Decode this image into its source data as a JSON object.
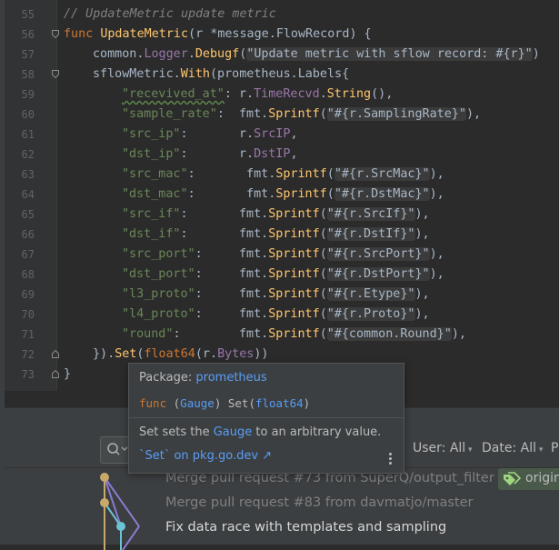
{
  "editor": {
    "lines": [
      {
        "n": "55"
      },
      {
        "n": "56"
      },
      {
        "n": "57"
      },
      {
        "n": "58"
      },
      {
        "n": "59"
      },
      {
        "n": "60"
      },
      {
        "n": "61"
      },
      {
        "n": "62"
      },
      {
        "n": "63"
      },
      {
        "n": "64"
      },
      {
        "n": "65"
      },
      {
        "n": "66"
      },
      {
        "n": "67"
      },
      {
        "n": "68"
      },
      {
        "n": "69"
      },
      {
        "n": "70"
      },
      {
        "n": "71"
      },
      {
        "n": "72"
      },
      {
        "n": "73"
      }
    ],
    "code": {
      "l55": "// UpdateMetric update metric",
      "l56_kw": "func",
      "l56_fn": "UpdateMetric",
      "l56_rest_a": "(r *",
      "l56_pkg": "message",
      "l56_dot": ".",
      "l56_type": "FlowRecord",
      "l56_rest_b": ") {",
      "l57_a": "common.",
      "l57_field": "Logger",
      "l57_b": ".",
      "l57_call": "Debugf",
      "l57_c": "(",
      "l57_str": "\"Update metric with sflow record: #{r}\"",
      "l57_d": ")",
      "l58_a": "sflowMetric.",
      "l58_call": "With",
      "l58_b": "(prometheus.",
      "l58_type": "Labels",
      "l58_c": "{",
      "l59_str": "\"recevived_at\"",
      "l59_a": ": r.",
      "l59_field": "TimeRecvd",
      "l59_b": ".",
      "l59_call": "String",
      "l59_c": "(),",
      "l60_str": "\"sample_rate\"",
      "l60_a": ":  fmt.",
      "l60_call": "Sprintf",
      "l60_b": "(",
      "l60_str2": "\"#{r.SamplingRate}\"",
      "l60_c": "),",
      "l61_str": "\"src_ip\"",
      "l61_a": ":       r.",
      "l61_field": "SrcIP",
      "l61_c": ",",
      "l62_str": "\"dst_ip\"",
      "l62_a": ":       r.",
      "l62_field": "DstIP",
      "l62_c": ",",
      "l63_str": "\"src_mac\"",
      "l63_a": ":       fmt.",
      "l63_call": "Sprintf",
      "l63_b": "(",
      "l63_str2": "\"#{r.SrcMac}\"",
      "l63_c": "),",
      "l64_str": "\"dst_mac\"",
      "l64_a": ":       fmt.",
      "l64_call": "Sprintf",
      "l64_b": "(",
      "l64_str2": "\"#{r.DstMac}\"",
      "l64_c": "),",
      "l65_str": "\"src_if\"",
      "l65_a": ":       fmt.",
      "l65_call": "Sprintf",
      "l65_b": "(",
      "l65_str2": "\"#{r.SrcIf}\"",
      "l65_c": "),",
      "l66_str": "\"dst_if\"",
      "l66_a": ":       fmt.",
      "l66_call": "Sprintf",
      "l66_b": "(",
      "l66_str2": "\"#{r.DstIf}\"",
      "l66_c": "),",
      "l67_str": "\"src_port\"",
      "l67_a": ":     fmt.",
      "l67_call": "Sprintf",
      "l67_b": "(",
      "l67_str2": "\"#{r.SrcPort}\"",
      "l67_c": "),",
      "l68_str": "\"dst_port\"",
      "l68_a": ":     fmt.",
      "l68_call": "Sprintf",
      "l68_b": "(",
      "l68_str2": "\"#{r.DstPort}\"",
      "l68_c": "),",
      "l69_str": "\"l3_proto\"",
      "l69_a": ":     fmt.",
      "l69_call": "Sprintf",
      "l69_b": "(",
      "l69_str2": "\"#{r.Etype}\"",
      "l69_c": "),",
      "l70_str": "\"l4_proto\"",
      "l70_a": ":     fmt.",
      "l70_call": "Sprintf",
      "l70_b": "(",
      "l70_str2": "\"#{r.Proto}\"",
      "l70_c": "),",
      "l71_str": "\"round\"",
      "l71_a": ":        fmt.",
      "l71_call": "Sprintf",
      "l71_b": "(",
      "l71_str2": "\"#{common.Round}\"",
      "l71_c": "),",
      "l72_a": "}).",
      "l72_call": "Set",
      "l72_b": "(",
      "l72_kw": "float64",
      "l72_c": "(r.",
      "l72_field": "Bytes",
      "l72_d": "))",
      "l73": "}"
    }
  },
  "popup": {
    "package_label": "Package:",
    "package_name": "prometheus",
    "sig_kw": "func",
    "sig_open": " (",
    "sig_recv": "Gauge",
    "sig_mid": ") Set(",
    "sig_param": "float64",
    "sig_close": ")",
    "desc_a": "Set sets the ",
    "desc_link": "Gauge",
    "desc_b": " to an arbitrary value.",
    "doc_link": "`Set` on pkg.go.dev ↗"
  },
  "vcs": {
    "filter_user": "User: All",
    "filter_date": "Date: All",
    "filter_more": "P",
    "commits": [
      {
        "text": "Merge pull request #73 from SuperQ/output_filter"
      },
      {
        "text": "Merge pull request #83 from davmatjo/master"
      },
      {
        "text": "Fix data race with templates and sampling"
      }
    ],
    "tag": "origin"
  },
  "colors": {
    "editor_bg": "#2b2b2b",
    "keyword": "#cc7832",
    "function": "#ffc66d",
    "string": "#6a8759",
    "field": "#9876aa",
    "link": "#589df6"
  }
}
